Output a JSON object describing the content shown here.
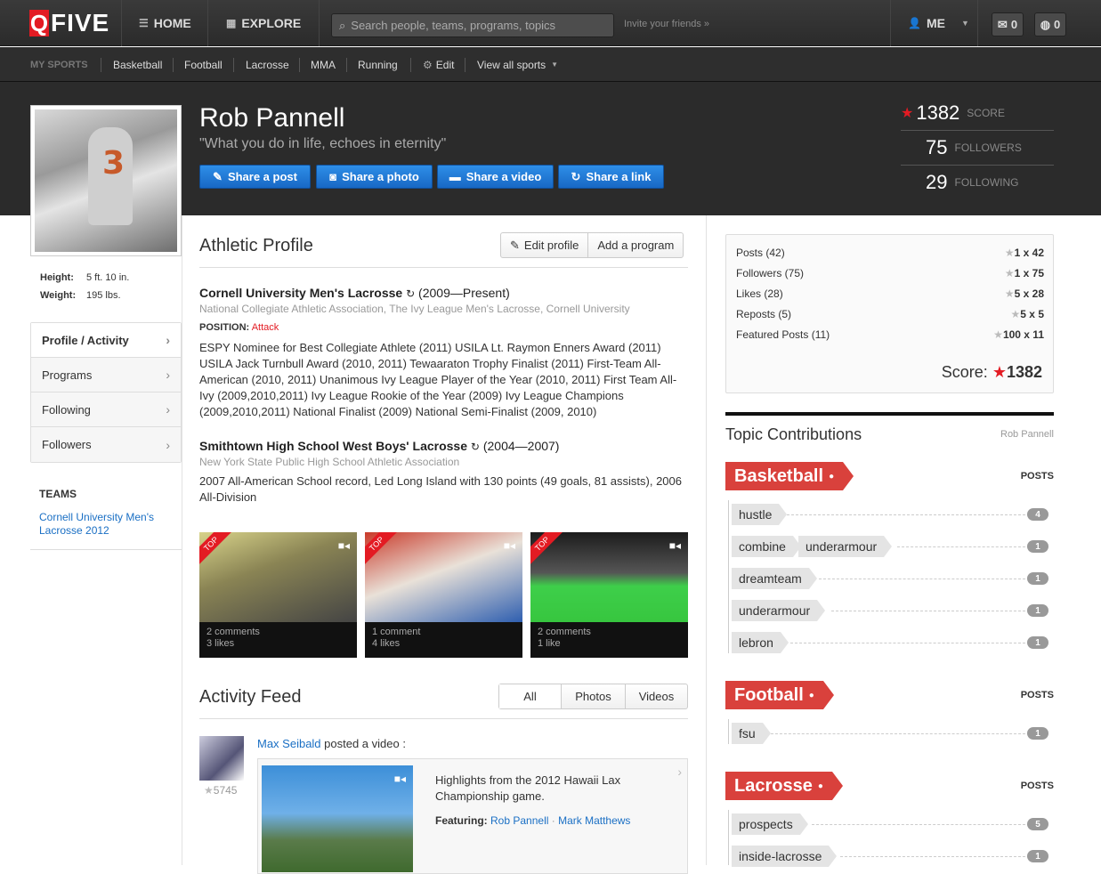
{
  "topnav": {
    "logo_q": "Q",
    "logo_rest": "FIVE",
    "home": "HOME",
    "explore": "EXPLORE",
    "search_placeholder": "Search people, teams, programs, topics",
    "invite": "Invite your friends »",
    "me": "ME",
    "messages_count": "0",
    "notifications_count": "0"
  },
  "subnav": {
    "label": "MY SPORTS",
    "items": [
      "Basketball",
      "Football",
      "Lacrosse",
      "MMA",
      "Running"
    ],
    "edit": "Edit",
    "view_all": "View all sports"
  },
  "profile": {
    "name": "Rob Pannell",
    "quote": "\"What you do in life, echoes in eternity\"",
    "share_buttons": [
      "Share a post",
      "Share a photo",
      "Share a video",
      "Share a link"
    ],
    "stats": [
      {
        "num": "1382",
        "label": "SCORE"
      },
      {
        "num": "75",
        "label": "FOLLOWERS"
      },
      {
        "num": "29",
        "label": "FOLLOWING"
      }
    ],
    "height_label": "Height:",
    "height": "5 ft. 10 in.",
    "weight_label": "Weight:",
    "weight": "195 lbs."
  },
  "leftnav": {
    "items": [
      "Profile / Activity",
      "Programs",
      "Following",
      "Followers"
    ],
    "teams_heading": "TEAMS",
    "team_link": "Cornell University Men's Lacrosse 2012"
  },
  "athletic": {
    "title": "Athletic Profile",
    "edit_profile": "Edit profile",
    "add_program": "Add a program",
    "programs": [
      {
        "name": "Cornell University Men's Lacrosse",
        "years": "(2009—Present)",
        "orgs": "National Collegiate Athletic Association, The Ivy League Men's Lacrosse, Cornell University",
        "position_label": "POSITION:",
        "position": "Attack",
        "desc": "ESPY Nominee for Best Collegiate Athlete (2011) USILA Lt. Raymon Enners Award (2011) USILA Jack Turnbull Award (2010, 2011) Tewaaraton Trophy Finalist (2011) First-Team All-American (2010, 2011) Unanimous Ivy League Player of the Year (2010, 2011) First Team All-Ivy (2009,2010,2011) Ivy League Rookie of the Year (2009) Ivy League Champions (2009,2010,2011) National Finalist (2009) National Semi-Finalist (2009, 2010)"
      },
      {
        "name": "Smithtown High School West Boys' Lacrosse",
        "years": "(2004—2007)",
        "orgs": "New York State Public High School Athletic Association",
        "desc": "2007 All-American School record, Led Long Island with 130 points (49 goals, 81 assists), 2006 All-Division"
      }
    ],
    "thumbs": [
      {
        "ribbon": "TOP",
        "comments": "2 comments",
        "likes": "3 likes"
      },
      {
        "ribbon": "TOP",
        "comments": "1 comment",
        "likes": "4 likes"
      },
      {
        "ribbon": "TOP",
        "comments": "2 comments",
        "likes": "1 like"
      }
    ]
  },
  "feed": {
    "title": "Activity Feed",
    "tabs": [
      "All",
      "Photos",
      "Videos"
    ],
    "item": {
      "user": "Max Seibald",
      "action": " posted a video :",
      "score": "5745",
      "text": "Highlights from the 2012 Hawaii Lax Championship game.",
      "featuring_label": "Featuring:",
      "featuring": [
        "Rob Pannell",
        "Mark Matthews"
      ],
      "separator": " · "
    }
  },
  "scorebox": {
    "rows": [
      {
        "label": "Posts (42)",
        "value": "1 x 42"
      },
      {
        "label": "Followers (75)",
        "value": "1 x 75"
      },
      {
        "label": "Likes (28)",
        "value": "5 x 28"
      },
      {
        "label": "Reposts (5)",
        "value": "5 x 5"
      },
      {
        "label": "Featured Posts (11)",
        "value": "100 x 11"
      }
    ],
    "total_label": "Score:",
    "total": "1382"
  },
  "topics": {
    "title": "Topic Contributions",
    "by": "Rob Pannell",
    "posts_label": "POSTS",
    "sports": [
      {
        "name": "Basketball",
        "rows": [
          {
            "tags": [
              "hustle"
            ],
            "count": "4"
          },
          {
            "tags": [
              "combine",
              "underarmour"
            ],
            "count": "1"
          },
          {
            "tags": [
              "dreamteam"
            ],
            "count": "1"
          },
          {
            "tags": [
              "underarmour"
            ],
            "count": "1"
          },
          {
            "tags": [
              "lebron"
            ],
            "count": "1"
          }
        ]
      },
      {
        "name": "Football",
        "rows": [
          {
            "tags": [
              "fsu"
            ],
            "count": "1"
          }
        ]
      },
      {
        "name": "Lacrosse",
        "rows": [
          {
            "tags": [
              "prospects"
            ],
            "count": "5"
          },
          {
            "tags": [
              "inside-lacrosse"
            ],
            "count": "1"
          }
        ]
      }
    ]
  },
  "colors": {
    "accent_red": "#e31b23",
    "link_blue": "#1a6fc4",
    "button_blue": "#1f78d4",
    "tag_red": "#d9413c"
  }
}
